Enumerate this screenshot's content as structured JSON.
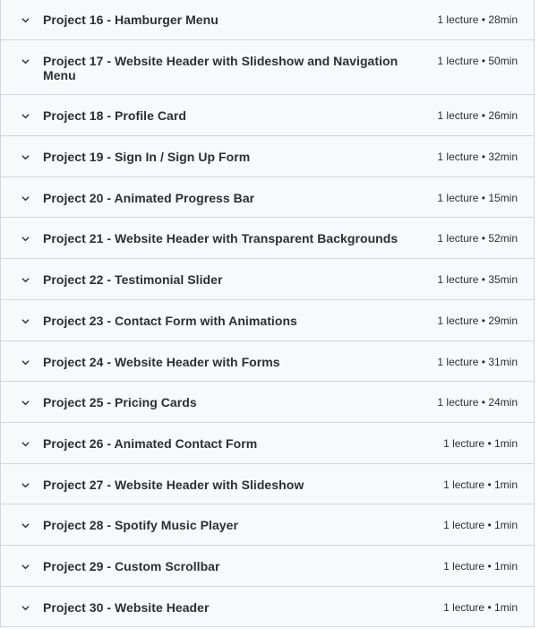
{
  "sections": [
    {
      "title": "Project 16 - Hamburger Menu",
      "lectures": "1 lecture",
      "duration": "28min"
    },
    {
      "title": "Project 17 - Website Header with Slideshow and Navigation Menu",
      "lectures": "1 lecture",
      "duration": "50min"
    },
    {
      "title": "Project 18 - Profile Card",
      "lectures": "1 lecture",
      "duration": "26min"
    },
    {
      "title": "Project 19 - Sign In / Sign Up Form",
      "lectures": "1 lecture",
      "duration": "32min"
    },
    {
      "title": "Project 20 - Animated Progress Bar",
      "lectures": "1 lecture",
      "duration": "15min"
    },
    {
      "title": "Project 21 - Website Header with Transparent Backgrounds",
      "lectures": "1 lecture",
      "duration": "52min"
    },
    {
      "title": "Project 22 - Testimonial Slider",
      "lectures": "1 lecture",
      "duration": "35min"
    },
    {
      "title": "Project 23 - Contact Form with Animations",
      "lectures": "1 lecture",
      "duration": "29min"
    },
    {
      "title": "Project 24 - Website Header with Forms",
      "lectures": "1 lecture",
      "duration": "31min"
    },
    {
      "title": "Project 25 - Pricing Cards",
      "lectures": "1 lecture",
      "duration": "24min"
    },
    {
      "title": "Project 26 - Animated Contact Form",
      "lectures": "1 lecture",
      "duration": "1min"
    },
    {
      "title": "Project 27 - Website Header with Slideshow",
      "lectures": "1 lecture",
      "duration": "1min"
    },
    {
      "title": "Project 28 - Spotify Music Player",
      "lectures": "1 lecture",
      "duration": "1min"
    },
    {
      "title": "Project 29 - Custom Scrollbar",
      "lectures": "1 lecture",
      "duration": "1min"
    },
    {
      "title": "Project 30 - Website Header",
      "lectures": "1 lecture",
      "duration": "1min"
    }
  ],
  "separator": " • ",
  "icons": {
    "expand": "chevron-down-icon"
  }
}
